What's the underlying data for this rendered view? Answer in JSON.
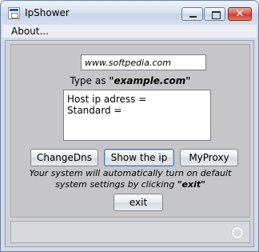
{
  "window": {
    "title": "IpShower"
  },
  "menu": {
    "items": [
      {
        "label": "About..."
      }
    ]
  },
  "url_input": {
    "value": "www.softpedia.com"
  },
  "hint": {
    "prefix": "Type as ",
    "example": "\"example.com\""
  },
  "info": {
    "lines": [
      "Host ip adress =",
      "Standard ="
    ]
  },
  "buttons": {
    "change_dns": "ChangeDns",
    "show_ip": "Show the ip",
    "my_proxy": "MyProxy",
    "exit": "exit"
  },
  "note": {
    "text": "Your system will automatically turn on default system settings by clicking ",
    "emphasis": "\"exit\""
  },
  "icons": {
    "app": "app-window-icon",
    "minimize": "minimize-icon",
    "maximize": "maximize-icon",
    "close": "close-icon",
    "status": "status-ring-icon"
  }
}
